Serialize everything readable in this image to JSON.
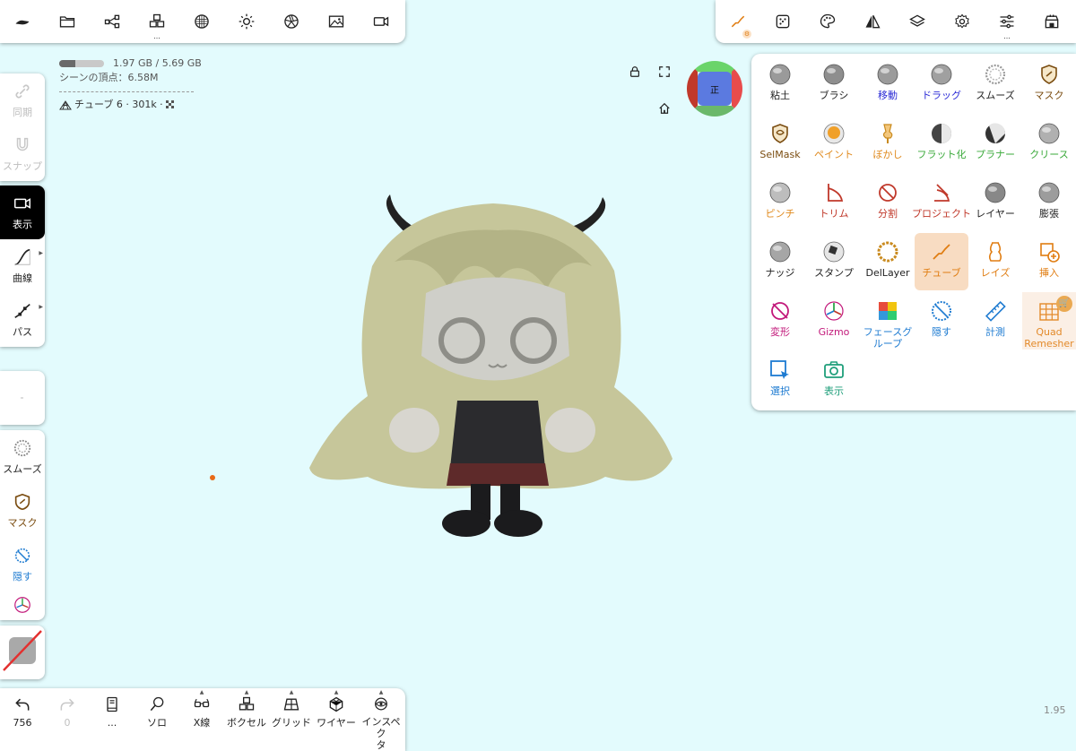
{
  "topbar_left": {
    "icons": [
      "sculpt-menu-icon",
      "folder-icon",
      "scene-graph-icon",
      "voxel-icon",
      "material-sphere-icon",
      "light-icon",
      "aperture-icon",
      "image-icon",
      "camera-icon"
    ],
    "voxel_more": "..."
  },
  "topbar_right": {
    "icons": [
      "tube-tool-icon",
      "dice-icon",
      "palette-icon",
      "symmetry-icon",
      "layers-icon",
      "settings-gear-icon",
      "sliders-icon",
      "shop-icon"
    ],
    "sliders_more": "..."
  },
  "info": {
    "memory": "1.97 GB / 5.69 GB",
    "memory_fraction": 0.35,
    "vertices": "シーンの頂点：6.58M",
    "object": "チューブ 6 · 301k ·"
  },
  "view_tools": {
    "lock": "lock-icon",
    "fullscreen": "fullscreen-icon",
    "home": "home-icon"
  },
  "nav_cube": {
    "face_label": "正",
    "colors": {
      "face": "#5b7ae0",
      "top": "#6ad46a",
      "left": "#c0392b",
      "right": "#e84c4c"
    }
  },
  "left_tools": {
    "sync": "同期",
    "snap": "スナップ",
    "display": "表示",
    "curve": "曲線",
    "path": "パス",
    "smooth": "スムーズ",
    "mask": "マスク",
    "hide": "隠す"
  },
  "tools": [
    {
      "label": "粘土",
      "color": "#222",
      "icon": "clay-icon"
    },
    {
      "label": "ブラシ",
      "color": "#222",
      "icon": "brush-icon"
    },
    {
      "label": "移動",
      "color": "#2b2bd6",
      "icon": "move-icon"
    },
    {
      "label": "ドラッグ",
      "color": "#2b2bd6",
      "icon": "drag-icon"
    },
    {
      "label": "スムーズ",
      "color": "#222",
      "icon": "smooth-icon"
    },
    {
      "label": "マスク",
      "color": "#7a4c10",
      "icon": "mask-icon"
    },
    {
      "label": "SelMask",
      "color": "#7a4c10",
      "icon": "selmask-icon"
    },
    {
      "label": "ペイント",
      "color": "#e08a1e",
      "icon": "paint-icon"
    },
    {
      "label": "ぼかし",
      "color": "#e08a1e",
      "icon": "smudge-icon"
    },
    {
      "label": "フラット化",
      "color": "#3aa93a",
      "icon": "flatten-icon"
    },
    {
      "label": "プラナー",
      "color": "#3aa93a",
      "icon": "planar-icon"
    },
    {
      "label": "クリース",
      "color": "#3aa93a",
      "icon": "crease-icon"
    },
    {
      "label": "ピンチ",
      "color": "#e08a1e",
      "icon": "pinch-icon"
    },
    {
      "label": "トリム",
      "color": "#c0392b",
      "icon": "trim-icon"
    },
    {
      "label": "分割",
      "color": "#c0392b",
      "icon": "split-icon"
    },
    {
      "label": "プロジェクト",
      "color": "#c0392b",
      "icon": "project-icon"
    },
    {
      "label": "レイヤー",
      "color": "#222",
      "icon": "layer-icon"
    },
    {
      "label": "膨張",
      "color": "#222",
      "icon": "inflate-icon"
    },
    {
      "label": "ナッジ",
      "color": "#222",
      "icon": "nudge-icon"
    },
    {
      "label": "スタンプ",
      "color": "#222",
      "icon": "stamp-icon"
    },
    {
      "label": "DelLayer",
      "color": "#222",
      "icon": "dellayer-icon"
    },
    {
      "label": "チューブ",
      "color": "#e07d12",
      "icon": "tube-icon"
    },
    {
      "label": "レイズ",
      "color": "#e07d12",
      "icon": "lathe-icon"
    },
    {
      "label": "挿入",
      "color": "#e07d12",
      "icon": "insert-icon"
    },
    {
      "label": "変形",
      "color": "#c2187a",
      "icon": "transform-icon"
    },
    {
      "label": "Gizmo",
      "color": "#c2187a",
      "icon": "gizmo-icon"
    },
    {
      "label": "フェースグループ",
      "line1": "フェースグ",
      "line2": "ループ",
      "color": "#1e7bd1",
      "icon": "facegroup-icon"
    },
    {
      "label": "隠す",
      "color": "#1e7bd1",
      "icon": "hide-icon"
    },
    {
      "label": "計測",
      "color": "#1e7bd1",
      "icon": "measure-icon"
    },
    {
      "label": "Quad Remesher",
      "line1": "Quad",
      "line2": "Remesher",
      "color": "#e07d12",
      "icon": "quad-remesher-icon"
    },
    {
      "label": "選択",
      "color": "#1e7bd1",
      "icon": "select-icon"
    },
    {
      "label": "表示",
      "color": "#1e9e7a",
      "icon": "show-icon"
    }
  ],
  "bottom": {
    "undo_count": "756",
    "redo_count": "0",
    "more": "...",
    "solo": "ソロ",
    "xray": "X線",
    "voxel": "ボクセル",
    "grid": "グリッド",
    "wire": "ワイヤー",
    "inspect_line1": "インスペク",
    "inspect_line2": "タ"
  },
  "version": "1.95"
}
